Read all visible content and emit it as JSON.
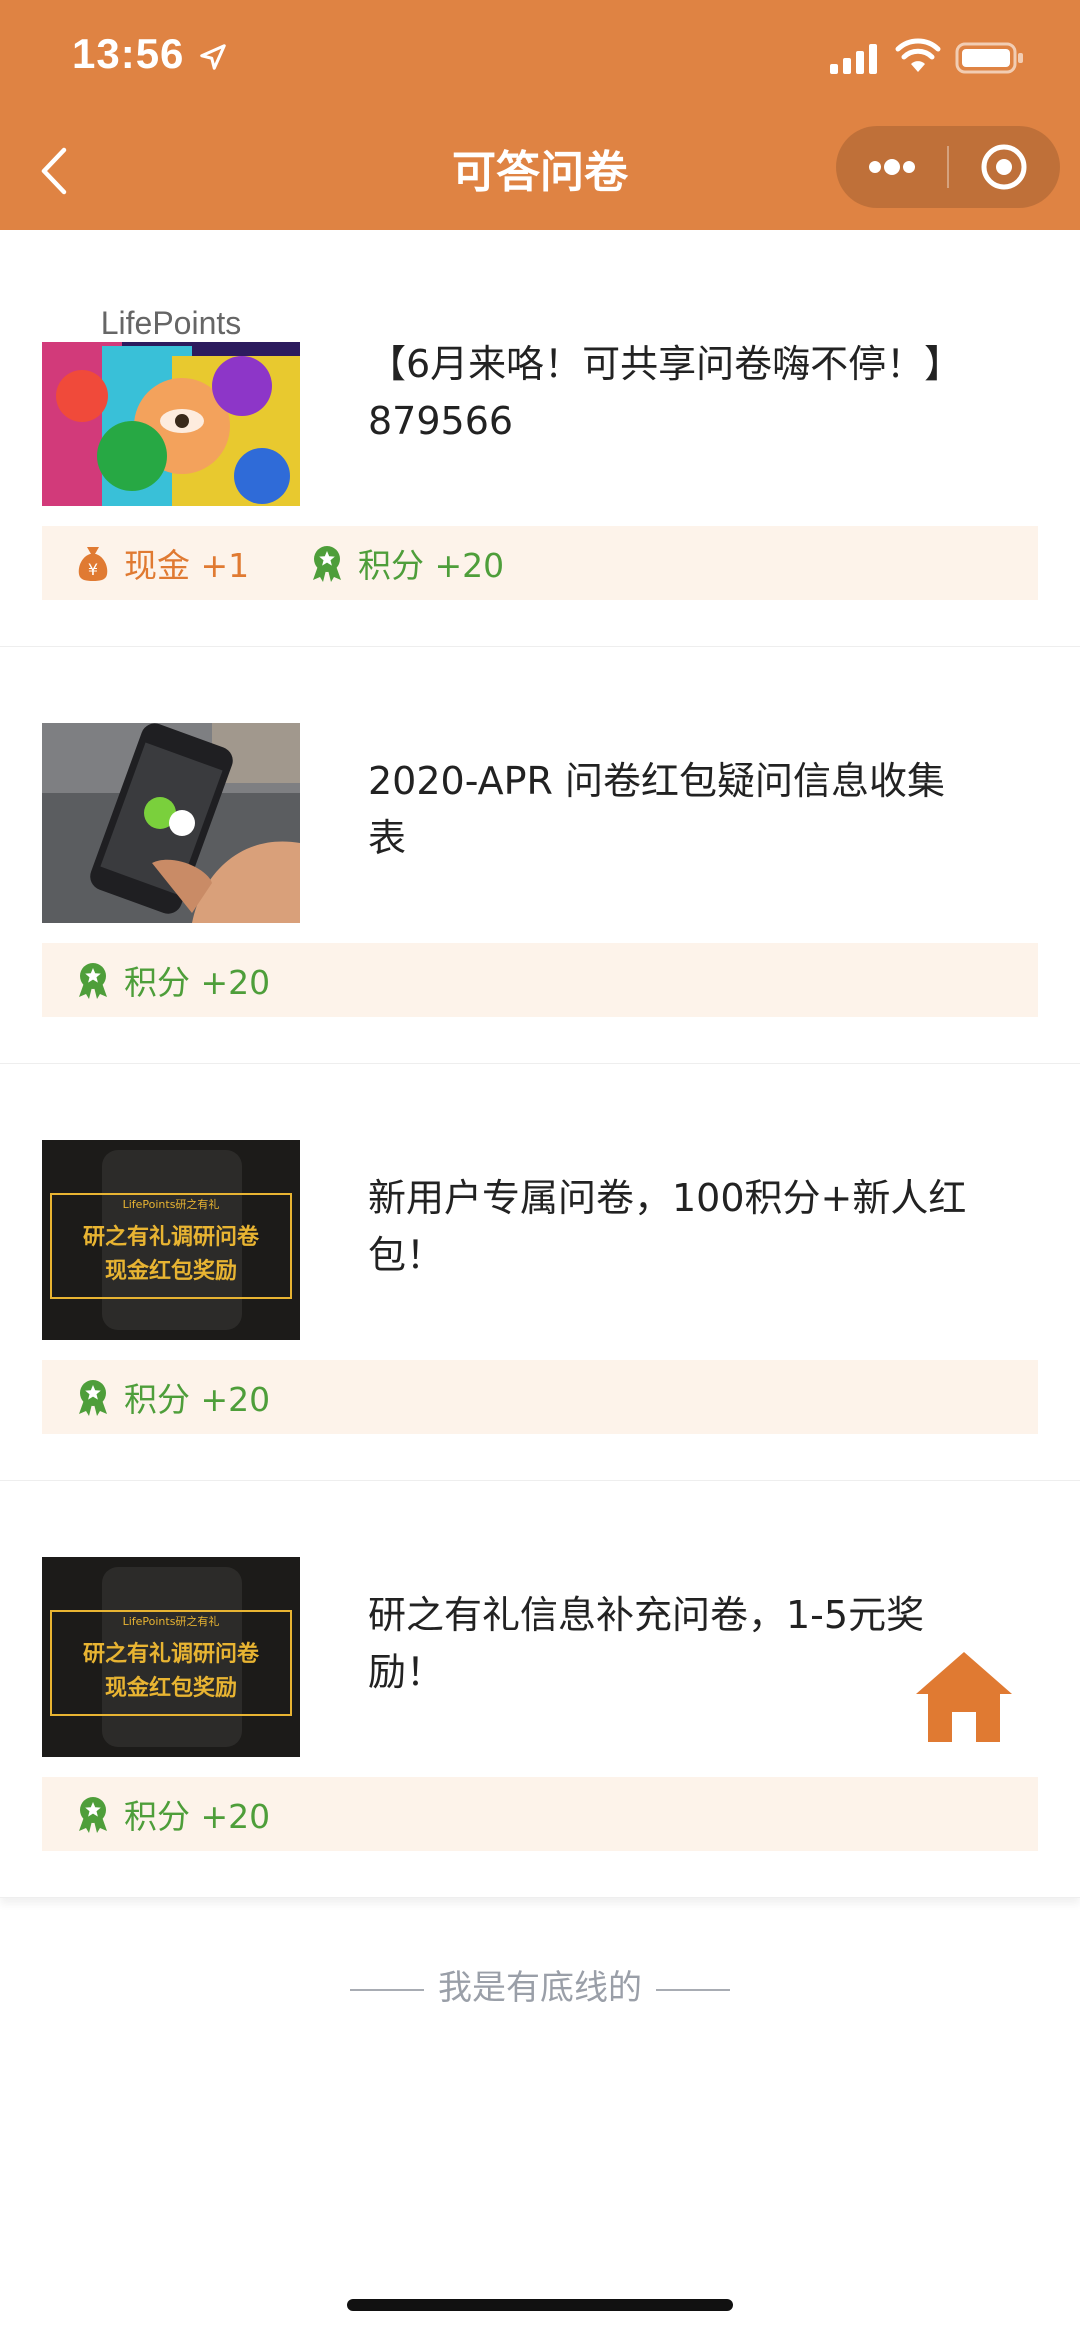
{
  "status_bar": {
    "time": "13:56"
  },
  "nav": {
    "title": "可答问卷"
  },
  "colors": {
    "header": "#DF8343",
    "cash": "#E07A32",
    "points": "#4E9E3A",
    "reward_bg": "#FDF3EA"
  },
  "surveys": [
    {
      "title": "【6月来咯！可共享问卷嗨不停！】879566",
      "image": "lifepoints-colorful-face",
      "thumb_text": "LifePoints",
      "cash_label": "现金 +1",
      "points_label": "积分 +20"
    },
    {
      "title": " 2020-APR 问卷红包疑问信息收集表",
      "image": "hand-holding-phone-wechat",
      "points_label": "积分 +20"
    },
    {
      "title": " 新用户专属问卷，100积分+新人红包！",
      "image": "banner-cash-reward",
      "thumb_top": "LifePoints研之有礼",
      "thumb_line1": "研之有礼调研问卷",
      "thumb_line2": "现金红包奖励",
      "points_label": "积分 +20"
    },
    {
      "title": " 研之有礼信息补充问卷，1-5元奖励！",
      "image": "banner-cash-reward",
      "thumb_top": "LifePoints研之有礼",
      "thumb_line1": "研之有礼调研问卷",
      "thumb_line2": "现金红包奖励",
      "points_label": "积分 +20"
    }
  ],
  "footer": {
    "end_text": "我是有底线的"
  }
}
